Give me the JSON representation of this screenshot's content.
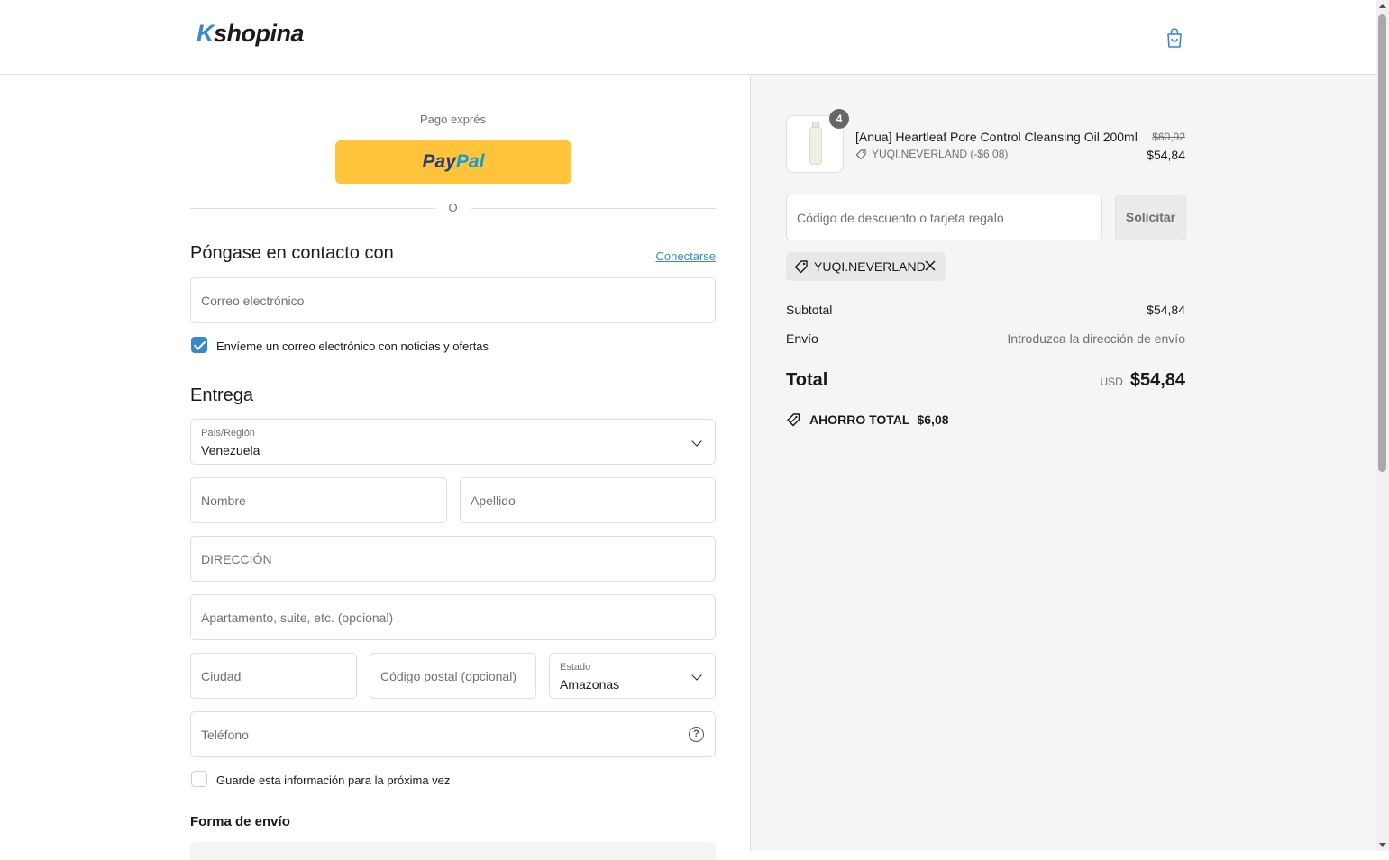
{
  "header": {
    "logo_k": "K",
    "logo_rest": "shopina",
    "cart_icon": "shopping-bag-icon"
  },
  "express": {
    "label": "Pago exprés",
    "paypal_part1": "Pay",
    "paypal_part2": "Pal",
    "or_text": "O"
  },
  "contact": {
    "title": "Póngase en contacto con",
    "login_link": "Conectarse",
    "email_placeholder": "Correo electrónico",
    "newsletter_label": "Envíeme un correo electrónico con noticias y ofertas",
    "newsletter_checked": true
  },
  "delivery": {
    "title": "Entrega",
    "country_label": "País/Región",
    "country_value": "Venezuela",
    "first_name_placeholder": "Nombre",
    "last_name_placeholder": "Apellido",
    "address_placeholder": "DIRECCIÓN",
    "apartment_placeholder": "Apartamento, suite, etc. (opcional)",
    "city_placeholder": "Ciudad",
    "postal_placeholder": "Código postal (opcional)",
    "state_label": "Estado",
    "state_value": "Amazonas",
    "phone_placeholder": "Teléfono",
    "save_info_label": "Guarde esta información para la próxima vez",
    "save_info_checked": false
  },
  "shipping": {
    "title": "Forma de envío"
  },
  "summary": {
    "product": {
      "quantity": "4",
      "name": "[Anua] Heartleaf Pore Control Cleansing Oil 200ml",
      "discount": "YUQI.NEVERLAND (-$6,08)",
      "old_price": "$60,92",
      "price": "$54,84"
    },
    "discount_placeholder": "Código de descuento o tarjeta regalo",
    "apply_label": "Solicitar",
    "applied_code": "YUQI.NEVERLAND",
    "subtotal_label": "Subtotal",
    "subtotal_value": "$54,84",
    "shipping_label": "Envío",
    "shipping_value": "Introduzca la dirección de envío",
    "total_label": "Total",
    "currency": "USD",
    "total_value": "$54,84",
    "savings_label": "AHORRO TOTAL",
    "savings_value": "$6,08"
  },
  "colors": {
    "accent": "#3a88c8",
    "paypal_yellow": "#ffc439",
    "summary_bg": "#f5f5f5"
  }
}
